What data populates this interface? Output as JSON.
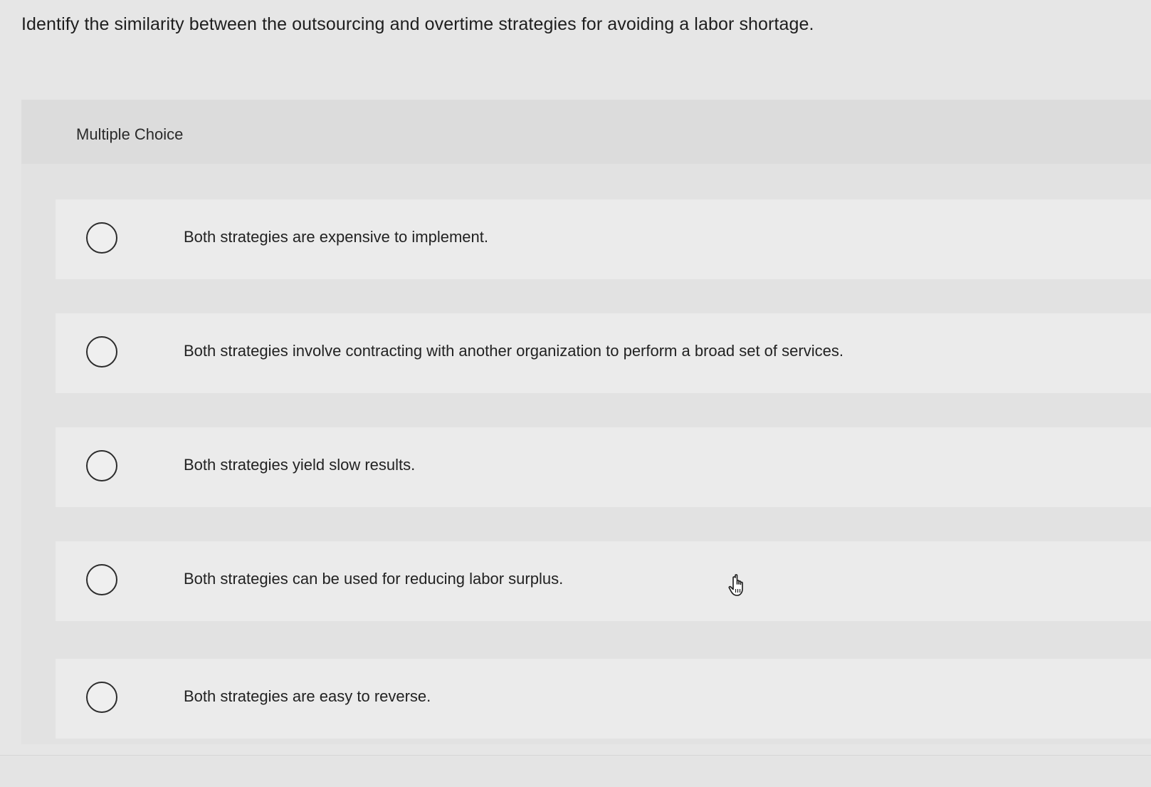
{
  "question": {
    "text": "Identify the similarity between the outsourcing and overtime strategies for avoiding a labor shortage."
  },
  "panel": {
    "label": "Multiple Choice"
  },
  "options": [
    {
      "label": "Both strategies are expensive to implement.",
      "selected": false
    },
    {
      "label": "Both strategies involve contracting with another organization to perform a broad set of services.",
      "selected": false
    },
    {
      "label": "Both strategies yield slow results.",
      "selected": false
    },
    {
      "label": "Both strategies can be used for reducing labor surplus.",
      "selected": false
    },
    {
      "label": "Both strategies are easy to reverse.",
      "selected": false
    }
  ],
  "icons": {
    "cursor": "hand-pointer-icon",
    "radio": "radio-circle-icon"
  },
  "colors": {
    "background": "#e6e6e6",
    "panel": "#e2e2e2",
    "option_bg": "#ebebeb",
    "text": "#1f1f1f"
  }
}
